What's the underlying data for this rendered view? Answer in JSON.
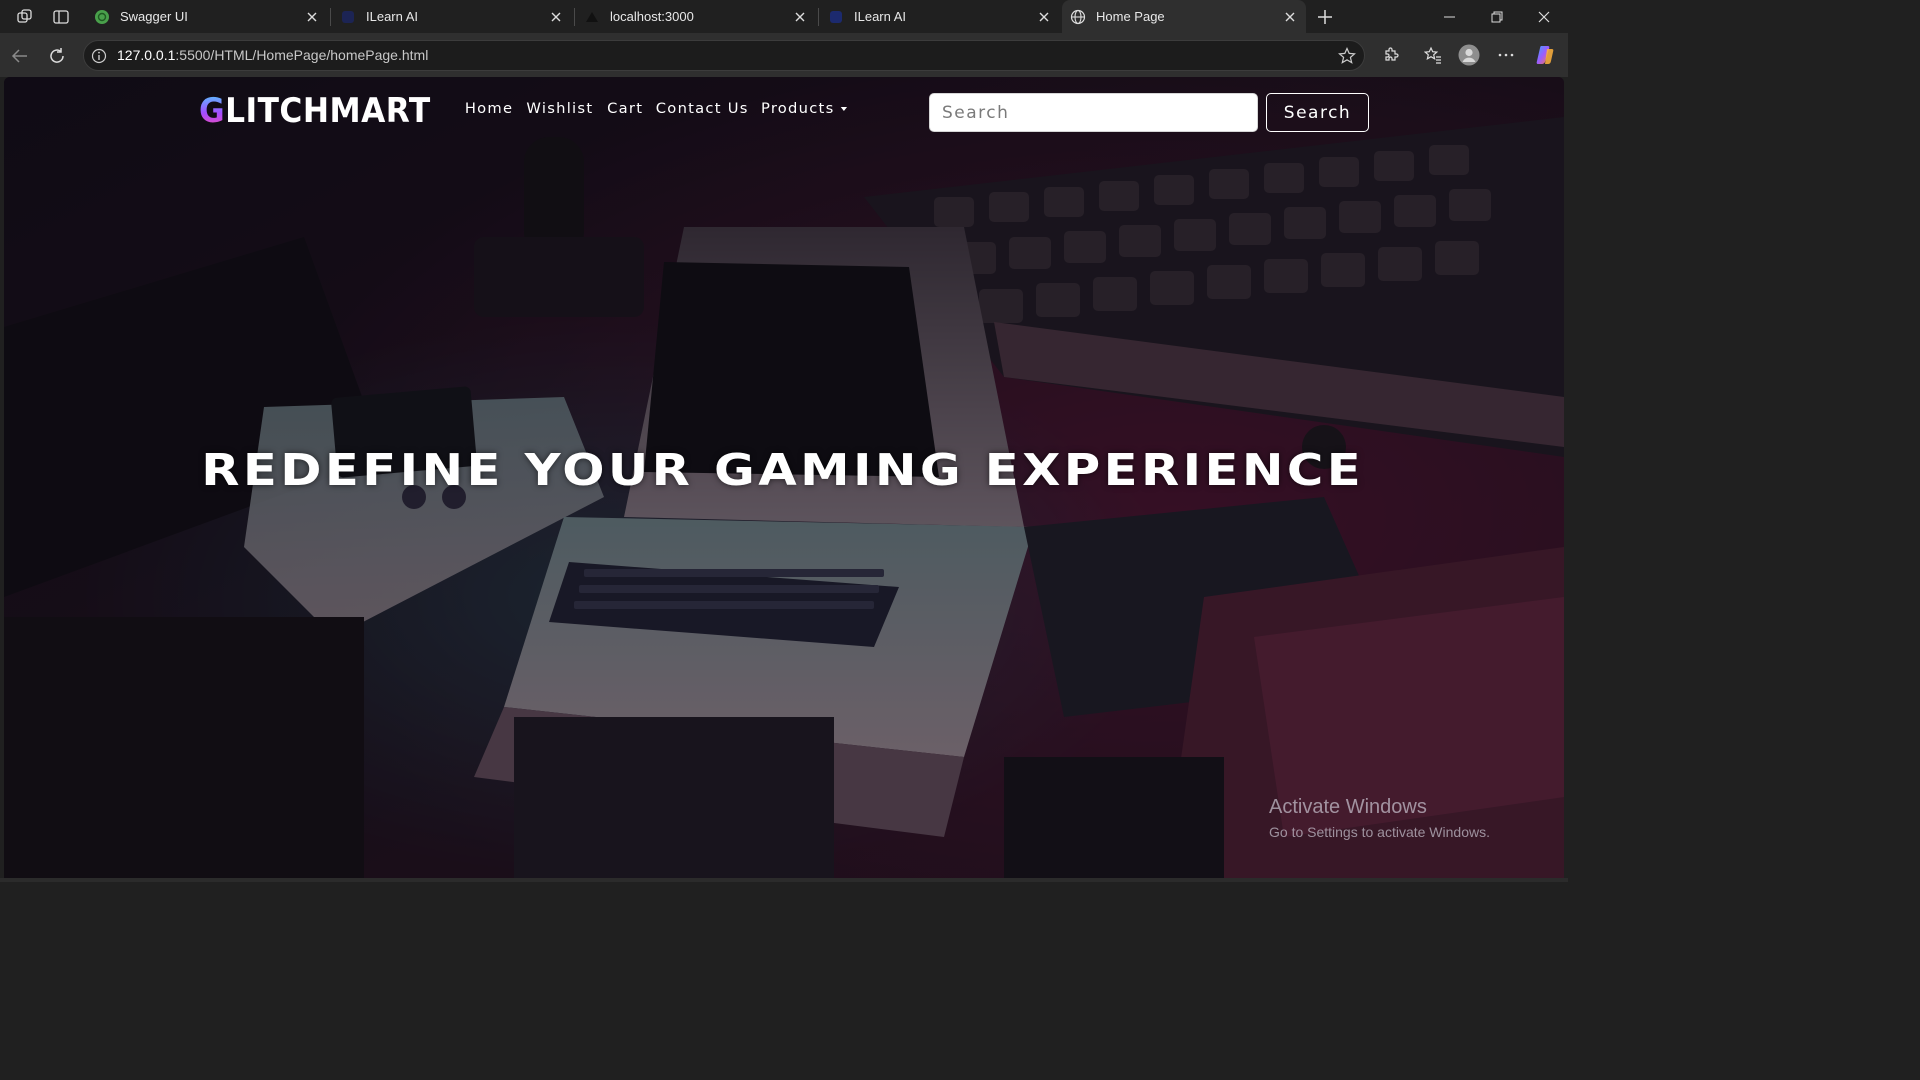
{
  "browser": {
    "tabs": [
      {
        "title": "Swagger UI",
        "favicon": "swagger-icon",
        "active": false
      },
      {
        "title": "ILearn AI",
        "favicon": "ilearn-icon",
        "active": false
      },
      {
        "title": "localhost:3000",
        "favicon": "triangle-icon",
        "active": false
      },
      {
        "title": "ILearn AI",
        "favicon": "ilearn-icon",
        "active": false
      },
      {
        "title": "Home Page",
        "favicon": "globe-icon",
        "active": true
      }
    ],
    "url_host": "127.0.0.1",
    "url_path": ":5500/HTML/HomePage/homePage.html"
  },
  "site": {
    "logo_first": "G",
    "logo_rest": "LITCHMART",
    "nav": {
      "home": "Home",
      "wishlist": "Wishlist",
      "cart": "Cart",
      "contact": "Contact Us",
      "products": "Products"
    },
    "search": {
      "placeholder": "Search",
      "button": "Search"
    },
    "hero_title": "REDEFINE YOUR GAMING EXPERIENCE"
  },
  "watermark": {
    "line1": "Activate Windows",
    "line2": "Go to Settings to activate Windows."
  },
  "colors": {
    "chrome_bg": "#202020",
    "toolbar_bg": "#2f2f2f",
    "hero_tint_magenta": "#b0245e",
    "hero_tint_cyan": "#2aa6b8"
  }
}
